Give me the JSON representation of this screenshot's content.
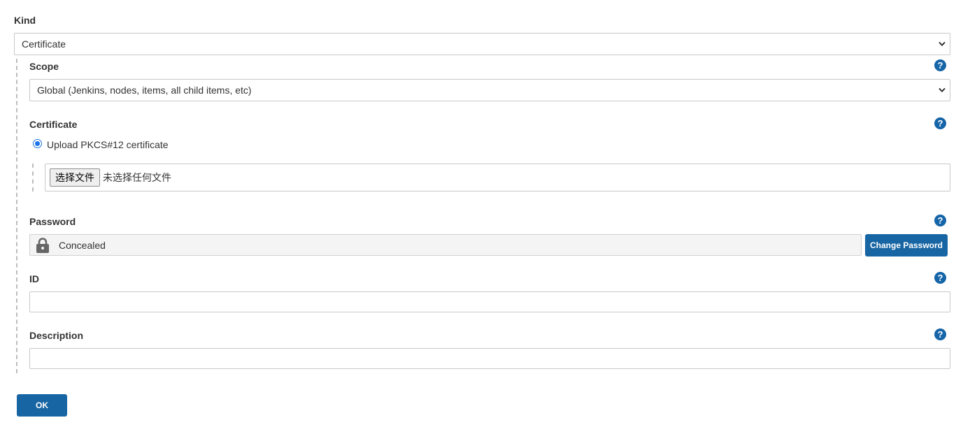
{
  "kind": {
    "label": "Kind",
    "selected": "Certificate"
  },
  "scope": {
    "label": "Scope",
    "selected": "Global (Jenkins, nodes, items, all child items, etc)",
    "help": "?"
  },
  "certificate": {
    "label": "Certificate",
    "help": "?",
    "option_label": "Upload PKCS#12 certificate",
    "file_button": "选择文件",
    "file_status": "未选择任何文件"
  },
  "password": {
    "label": "Password",
    "help": "?",
    "value": "Concealed",
    "change_button": "Change Password"
  },
  "id": {
    "label": "ID",
    "help": "?",
    "value": ""
  },
  "description": {
    "label": "Description",
    "help": "?",
    "value": ""
  },
  "ok_button": "OK",
  "colors": {
    "accent": "#1765a3",
    "help_icon": "#1565a8",
    "radio": "#1a73e8"
  },
  "icons": {
    "dropdown": "chevron-down-icon",
    "help": "help-icon",
    "lock": "lock-icon"
  }
}
